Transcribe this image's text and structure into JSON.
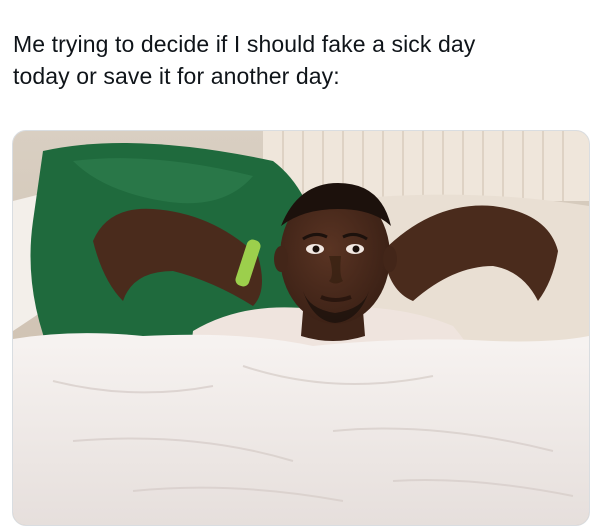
{
  "post": {
    "caption_line_1": "Me trying to decide if I should fake a sick day",
    "caption_line_2": "today or save it for another day:"
  },
  "photo": {
    "subject": "man-lying-in-bed-icon",
    "colors": {
      "headboard": "#e7ddd0",
      "pillow": "#1f6a3d",
      "sheet": "#f1ecea",
      "skin": "#4a2b1c",
      "shirt": "#efe4de"
    }
  }
}
